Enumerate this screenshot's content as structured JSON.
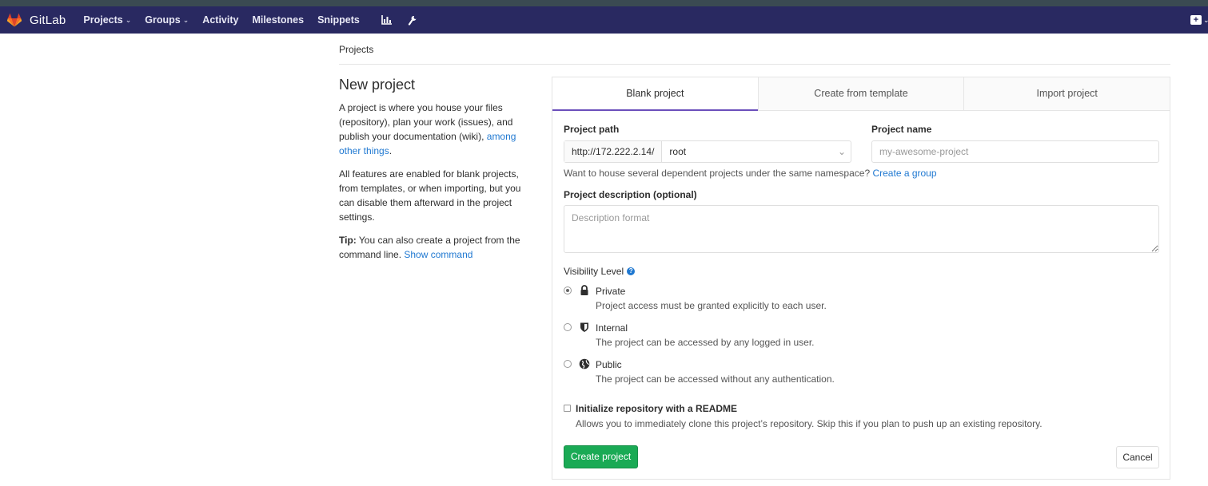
{
  "navbar": {
    "brand": "GitLab",
    "links": [
      {
        "label": "Projects",
        "caret": true
      },
      {
        "label": "Groups",
        "caret": true
      },
      {
        "label": "Activity",
        "caret": false
      },
      {
        "label": "Milestones",
        "caret": false
      },
      {
        "label": "Snippets",
        "caret": false
      }
    ],
    "icons": [
      "chart-icon",
      "wrench-icon"
    ],
    "plus": "+",
    "colors": {
      "bg": "#292961",
      "accent": "#fc6d26"
    }
  },
  "breadcrumb": "Projects",
  "sidebar": {
    "title": "New project",
    "p1_text": "A project is where you house your files (repository), plan your work (issues), and publish your documentation (wiki), ",
    "p1_link": "among other things",
    "p1_end": ".",
    "p2": "All features are enabled for blank projects, from templates, or when importing, but you can disable them afterward in the project settings.",
    "tip_bold": "Tip:",
    "tip_text": " You can also create a project from the command line. ",
    "tip_link": "Show command"
  },
  "tabs": [
    "Blank project",
    "Create from template",
    "Import project"
  ],
  "form": {
    "path_label": "Project path",
    "path_prefix": "http://172.222.2.14/",
    "namespace": "root",
    "name_label": "Project name",
    "name_placeholder": "my-awesome-project",
    "help_text": "Want to house several dependent projects under the same namespace? ",
    "help_link": "Create a group",
    "desc_label": "Project description (optional)",
    "desc_placeholder": "Description format",
    "visibility_label": "Visibility Level",
    "visibility_options": [
      {
        "title": "Private",
        "desc": "Project access must be granted explicitly to each user.",
        "checked": true,
        "icon": "lock-icon"
      },
      {
        "title": "Internal",
        "desc": "The project can be accessed by any logged in user.",
        "checked": false,
        "icon": "shield-icon"
      },
      {
        "title": "Public",
        "desc": "The project can be accessed without any authentication.",
        "checked": false,
        "icon": "globe-icon"
      }
    ],
    "readme_title": "Initialize repository with a README",
    "readme_desc": "Allows you to immediately clone this project’s repository. Skip this if you plan to push up an existing repository.",
    "create_label": "Create project",
    "cancel_label": "Cancel"
  }
}
